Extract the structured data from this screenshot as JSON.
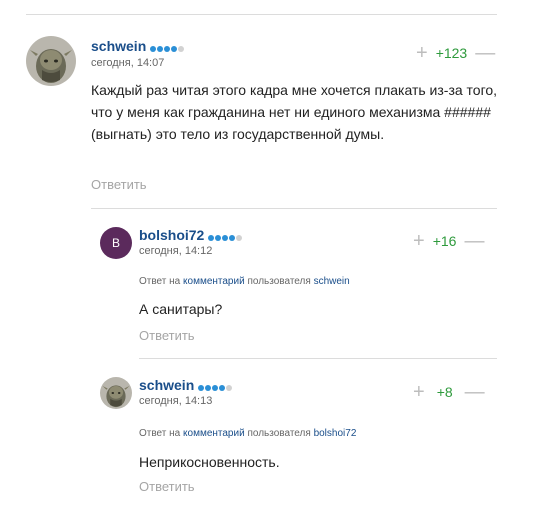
{
  "comments": [
    {
      "author": "schwein",
      "time": "сегодня, 14:07",
      "score": "+123",
      "text": "Каждый раз читая этого кадра мне хочется плакать из-за того, что у меня как гражданина нет ни единого механизма ###### (выгнать) это тело из государственной думы.",
      "reply_label": "Ответить",
      "rating_dots": 4
    },
    {
      "author": "bolshoi72",
      "avatar_letter": "B",
      "avatar_color": "#5b2a5c",
      "time": "сегодня, 14:12",
      "score": "+16",
      "reply_prefix": "Ответ на",
      "reply_link": "комментарий",
      "reply_mid": "пользователя",
      "reply_user": "schwein",
      "text": "А санитары?",
      "reply_label": "Ответить",
      "rating_dots": 4
    },
    {
      "author": "schwein",
      "time": "сегодня, 14:13",
      "score": "+8",
      "reply_prefix": "Ответ на",
      "reply_link": "комментарий",
      "reply_mid": "пользователя",
      "reply_user": "bolshoi72",
      "text": "Неприкосновенность.",
      "reply_label": "Ответить",
      "rating_dots": 4
    }
  ],
  "vote_plus": "+",
  "vote_minus": "—",
  "colors": {
    "author": "#1a4e8a",
    "score": "#2e9a3c",
    "muted": "#a5a5a5"
  }
}
